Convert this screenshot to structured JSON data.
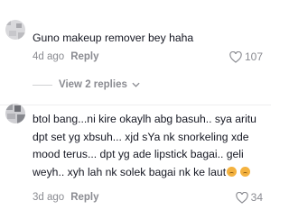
{
  "comments": [
    {
      "text_lines": [
        "Guno makeup remover bey haha"
      ],
      "age": "4d ago",
      "reply_label": "Reply",
      "like_count": "107"
    },
    {
      "text_lines": [
        "btol bang...ni kire okaylh abg basuh.. sya aritu",
        "dpt set yg xbsuh... xjd sYa nk snorkeling xde",
        "mood terus... dpt yg ade lipstick bagai.. geli",
        "weyh.. xyh lah nk solek bagai nk ke laut"
      ],
      "age": "3d ago",
      "reply_label": "Reply",
      "like_count": "34"
    }
  ],
  "view_replies_label": "View 2 replies",
  "icons": {
    "like": "heart-outline-icon",
    "expand": "chevron-down-icon",
    "emoji": "sad-face-emoji-icon"
  },
  "colors": {
    "text": "#161823",
    "meta": "#8a8b91"
  }
}
